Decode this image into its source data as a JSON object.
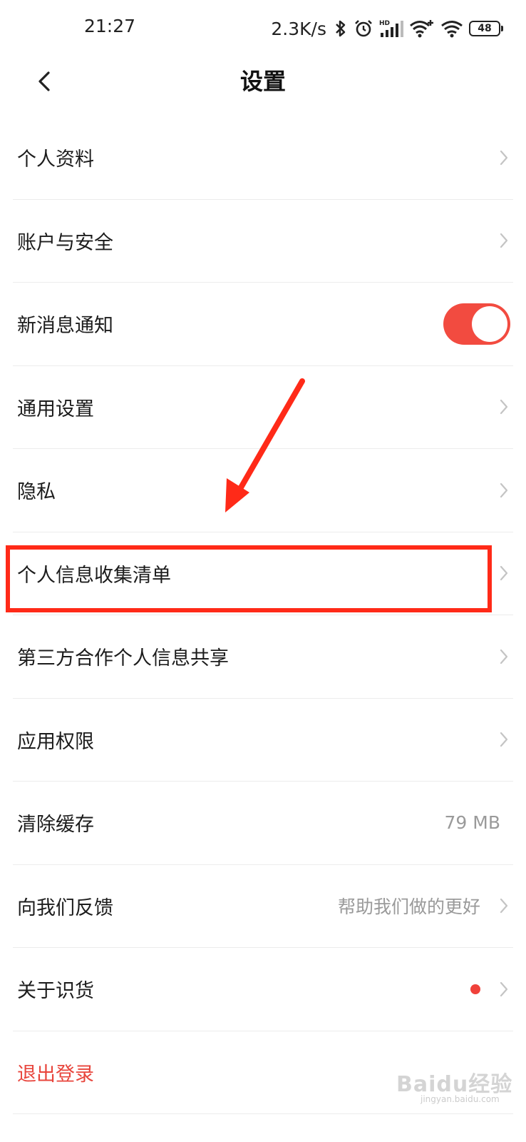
{
  "status_bar": {
    "time": "21:27",
    "net_speed": "2.3K/s",
    "battery": "48",
    "icons": [
      "bluetooth-icon",
      "alarm-icon",
      "hd-signal-icon",
      "wifi-plus-icon",
      "wifi-icon",
      "battery-icon"
    ]
  },
  "nav": {
    "title": "设置",
    "back_icon": "chevron-left-icon"
  },
  "settings": {
    "items": [
      {
        "label": "个人资料"
      },
      {
        "label": "账户与安全"
      },
      {
        "label": "新消息通知",
        "toggle_on": true
      },
      {
        "label": "通用设置"
      },
      {
        "label": "隐私"
      },
      {
        "label": "个人信息收集清单"
      },
      {
        "label": "第三方合作个人信息共享"
      },
      {
        "label": "应用权限"
      },
      {
        "label": "清除缓存",
        "value": "79 MB"
      },
      {
        "label": "向我们反馈",
        "value": "帮助我们做的更好"
      },
      {
        "label": "关于识货"
      },
      {
        "label": "退出登录"
      }
    ]
  },
  "annotation": {
    "highlight_color": "#ff2a18",
    "arrow_color": "#ff2a18"
  },
  "watermark": {
    "text": "Baidu经验",
    "sub": "jingyan.baidu.com"
  },
  "colors": {
    "accent_red": "#f24b40",
    "logout_red": "#e8453c",
    "secondary_text": "#9a9a9a"
  }
}
